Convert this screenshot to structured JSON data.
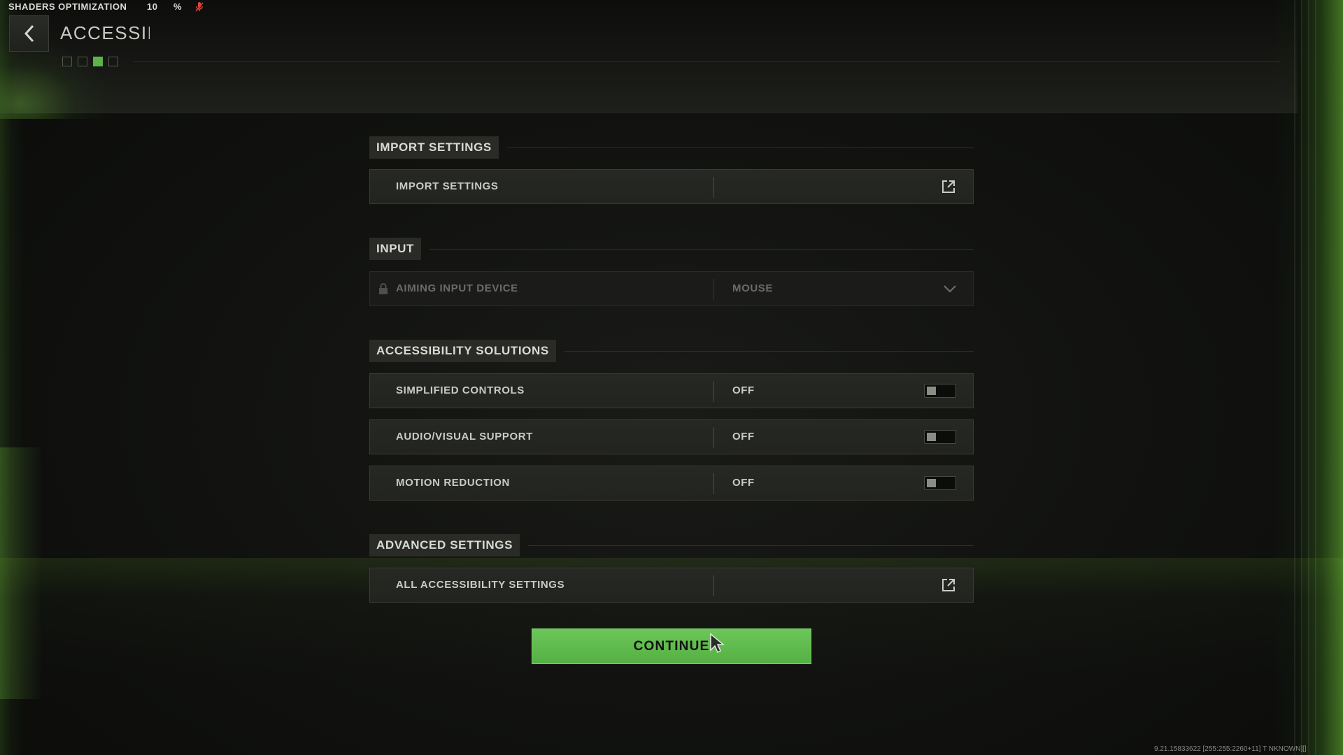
{
  "status": {
    "label": "SHADERS OPTIMIZATION",
    "value": "10",
    "unit": "%",
    "mic_icon": "mic-muted-icon"
  },
  "header": {
    "back_icon": "chevron-left-icon",
    "title": "ACCESSIBI",
    "steps": [
      {
        "state": "inactive"
      },
      {
        "state": "inactive"
      },
      {
        "state": "active"
      },
      {
        "state": "inactive"
      }
    ]
  },
  "sections": {
    "import": {
      "title": "IMPORT SETTINGS",
      "rows": [
        {
          "label": "IMPORT SETTINGS",
          "icon": "external-link-icon"
        }
      ]
    },
    "input": {
      "title": "INPUT",
      "rows": [
        {
          "label": "AIMING INPUT DEVICE",
          "value": "MOUSE",
          "locked": true,
          "icon": "chevron-down-icon"
        }
      ]
    },
    "accessibility": {
      "title": "ACCESSIBILITY SOLUTIONS",
      "rows": [
        {
          "label": "SIMPLIFIED CONTROLS",
          "value": "OFF",
          "toggle": false
        },
        {
          "label": "AUDIO/VISUAL SUPPORT",
          "value": "OFF",
          "toggle": false
        },
        {
          "label": "MOTION REDUCTION",
          "value": "OFF",
          "toggle": false
        }
      ]
    },
    "advanced": {
      "title": "ADVANCED SETTINGS",
      "rows": [
        {
          "label": "ALL ACCESSIBILITY SETTINGS",
          "icon": "external-link-icon"
        }
      ]
    }
  },
  "continue_label": "CONTINUE",
  "build_info": "9.21.15833622 [255:255:2260+11] T NKNOWN][]",
  "colors": {
    "accent": "#5bb349",
    "button": "#62bd4f",
    "panel": "#242622",
    "text": "#c9cbc5"
  }
}
